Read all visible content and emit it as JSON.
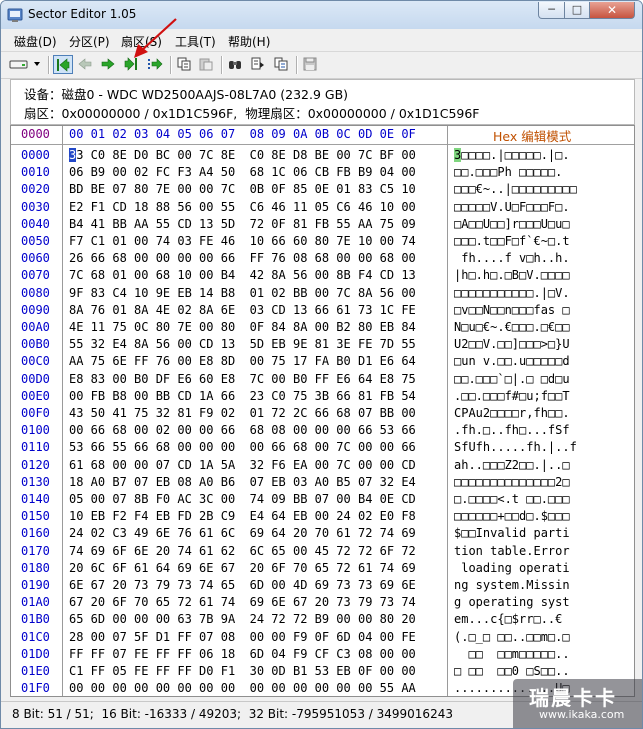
{
  "window": {
    "title": "Sector Editor 1.05",
    "min": "─",
    "max": "□",
    "close": "✕"
  },
  "menu": [
    "磁盘(D)",
    "分区(P)",
    "扇区(S)",
    "工具(T)",
    "帮助(H)"
  ],
  "toolbar": {
    "buttons": [
      "drive-dropdown",
      "first-sector",
      "previous-sector",
      "next-sector",
      "last-sector",
      "goto-sector",
      "copy",
      "paste",
      "find",
      "find-next",
      "replace",
      "save"
    ],
    "pressed": "first-sector"
  },
  "info": {
    "device_line": "设备：磁盘0 - WDC WD2500AAJS-08L7A0 (232.9 GB)",
    "sector_line": "扇区：0x00000000 / 0x1D1C596F,  物理扇区：0x00000000 / 0x1D1C596F"
  },
  "hex": {
    "offset_header": "0000",
    "columns_header": "00 01 02 03 04 05 06 07  08 09 0A 0B 0C 0D 0E 0F",
    "text_header_hex": "Hex",
    "text_header_mode": " 编辑模式",
    "rows": [
      {
        "off": "0000",
        "hex": "33 C0 8E D0 BC 00 7C 8E  C0 8E D8 BE 00 7C BF 00",
        "txt": "3□□□□.|□□□□□.|□."
      },
      {
        "off": "0010",
        "hex": "06 B9 00 02 FC F3 A4 50  68 1C 06 CB FB B9 04 00",
        "txt": "□□.□□□Ph □□□□□."
      },
      {
        "off": "0020",
        "hex": "BD BE 07 80 7E 00 00 7C  0B 0F 85 0E 01 83 C5 10",
        "txt": "□□□€~..|□□□□□□□□□"
      },
      {
        "off": "0030",
        "hex": "E2 F1 CD 18 88 56 00 55  C6 46 11 05 C6 46 10 00",
        "txt": "□□□□□V.U□F□□□F□."
      },
      {
        "off": "0040",
        "hex": "B4 41 BB AA 55 CD 13 5D  72 0F 81 FB 55 AA 75 09",
        "txt": "□A□□U□□]r□□□U□u□"
      },
      {
        "off": "0050",
        "hex": "F7 C1 01 00 74 03 FE 46  10 66 60 80 7E 10 00 74",
        "txt": "□□□.t□□F□f`€~□.t"
      },
      {
        "off": "0060",
        "hex": "26 66 68 00 00 00 00 66  FF 76 08 68 00 00 68 00",
        "txt": " fh....f v□h..h."
      },
      {
        "off": "0070",
        "hex": "7C 68 01 00 68 10 00 B4  42 8A 56 00 8B F4 CD 13",
        "txt": "|h□.h□.□B□V.□□□□"
      },
      {
        "off": "0080",
        "hex": "9F 83 C4 10 9E EB 14 B8  01 02 BB 00 7C 8A 56 00",
        "txt": "□□□□□□□□□□□.|□V."
      },
      {
        "off": "0090",
        "hex": "8A 76 01 8A 4E 02 8A 6E  03 CD 13 66 61 73 1C FE",
        "txt": "□v□□N□□n□□□fas □"
      },
      {
        "off": "00A0",
        "hex": "4E 11 75 0C 80 7E 00 80  0F 84 8A 00 B2 80 EB 84",
        "txt": "N□u□€~.€□□□.□€□□"
      },
      {
        "off": "00B0",
        "hex": "55 32 E4 8A 56 00 CD 13  5D EB 9E 81 3E FE 7D 55",
        "txt": "U2□□V.□□]□□□>□}U"
      },
      {
        "off": "00C0",
        "hex": "AA 75 6E FF 76 00 E8 8D  00 75 17 FA B0 D1 E6 64",
        "txt": "□un v.□□.u□□□□□d"
      },
      {
        "off": "00D0",
        "hex": "E8 83 00 B0 DF E6 60 E8  7C 00 B0 FF E6 64 E8 75",
        "txt": "□□.□□□`□|.□ □d□u"
      },
      {
        "off": "00E0",
        "hex": "00 FB B8 00 BB CD 1A 66  23 C0 75 3B 66 81 FB 54",
        "txt": ".□□.□□□f#□u;f□□T"
      },
      {
        "off": "00F0",
        "hex": "43 50 41 75 32 81 F9 02  01 72 2C 66 68 07 BB 00",
        "txt": "CPAu2□□□□r,fh□□."
      },
      {
        "off": "0100",
        "hex": "00 66 68 00 02 00 00 66  68 08 00 00 00 66 53 66",
        "txt": ".fh.□..fh□...fSf"
      },
      {
        "off": "0110",
        "hex": "53 66 55 66 68 00 00 00  00 66 68 00 7C 00 00 66",
        "txt": "SfUfh.....fh.|..f"
      },
      {
        "off": "0120",
        "hex": "61 68 00 00 07 CD 1A 5A  32 F6 EA 00 7C 00 00 CD",
        "txt": "ah..□□□Z2□□.|..□"
      },
      {
        "off": "0130",
        "hex": "18 A0 B7 07 EB 08 A0 B6  07 EB 03 A0 B5 07 32 E4",
        "txt": "□□□□□□□□□□□□□□2□"
      },
      {
        "off": "0140",
        "hex": "05 00 07 8B F0 AC 3C 00  74 09 BB 07 00 B4 0E CD",
        "txt": "□.□□□□<.t □□.□□□"
      },
      {
        "off": "0150",
        "hex": "10 EB F2 F4 EB FD 2B C9  E4 64 EB 00 24 02 E0 F8",
        "txt": "□□□□□□+□□d□.$□□□"
      },
      {
        "off": "0160",
        "hex": "24 02 C3 49 6E 76 61 6C  69 64 20 70 61 72 74 69",
        "txt": "$□□Invalid parti"
      },
      {
        "off": "0170",
        "hex": "74 69 6F 6E 20 74 61 62  6C 65 00 45 72 72 6F 72",
        "txt": "tion table.Error"
      },
      {
        "off": "0180",
        "hex": "20 6C 6F 61 64 69 6E 67  20 6F 70 65 72 61 74 69",
        "txt": " loading operati"
      },
      {
        "off": "0190",
        "hex": "6E 67 20 73 79 73 74 65  6D 00 4D 69 73 73 69 6E",
        "txt": "ng system.Missin"
      },
      {
        "off": "01A0",
        "hex": "67 20 6F 70 65 72 61 74  69 6E 67 20 73 79 73 74",
        "txt": "g operating syst"
      },
      {
        "off": "01B0",
        "hex": "65 6D 00 00 00 63 7B 9A  24 72 72 B9 00 00 80 20",
        "txt": "em...c{□$rr□..€ "
      },
      {
        "off": "01C0",
        "hex": "28 00 07 5F D1 FF 07 08  00 00 F9 0F 6D 04 00 FE",
        "txt": "(.□_□ □□..□□m□.□"
      },
      {
        "off": "01D0",
        "hex": "FF FF 07 FE FF FF 06 18  6D 04 F9 CF C3 08 00 00",
        "txt": "  □□  □□m□□□□□.."
      },
      {
        "off": "01E0",
        "hex": "C1 FF 05 FE FF FF D0 F1  30 0D B1 53 EB 0F 00 00",
        "txt": "□ □□  □□0 □S□□.."
      },
      {
        "off": "01F0",
        "hex": "00 00 00 00 00 00 00 00  00 00 00 00 00 00 55 AA",
        "txt": "..............U□"
      }
    ]
  },
  "status": "8 Bit: 51 / 51;  16 Bit: -16333 / 49203;  32 Bit: -795951053 / 3499016243",
  "watermark": {
    "cn": "瑞晨卡卡",
    "url": "www.ikaka.com"
  },
  "colors": {
    "offset": "#0000cc",
    "header_offset": "#800080",
    "cursor_hex": "#2248c8",
    "cursor_txt": "#7fd67f",
    "hex_title": "#c05000",
    "annotation_arrow": "#d01010"
  }
}
